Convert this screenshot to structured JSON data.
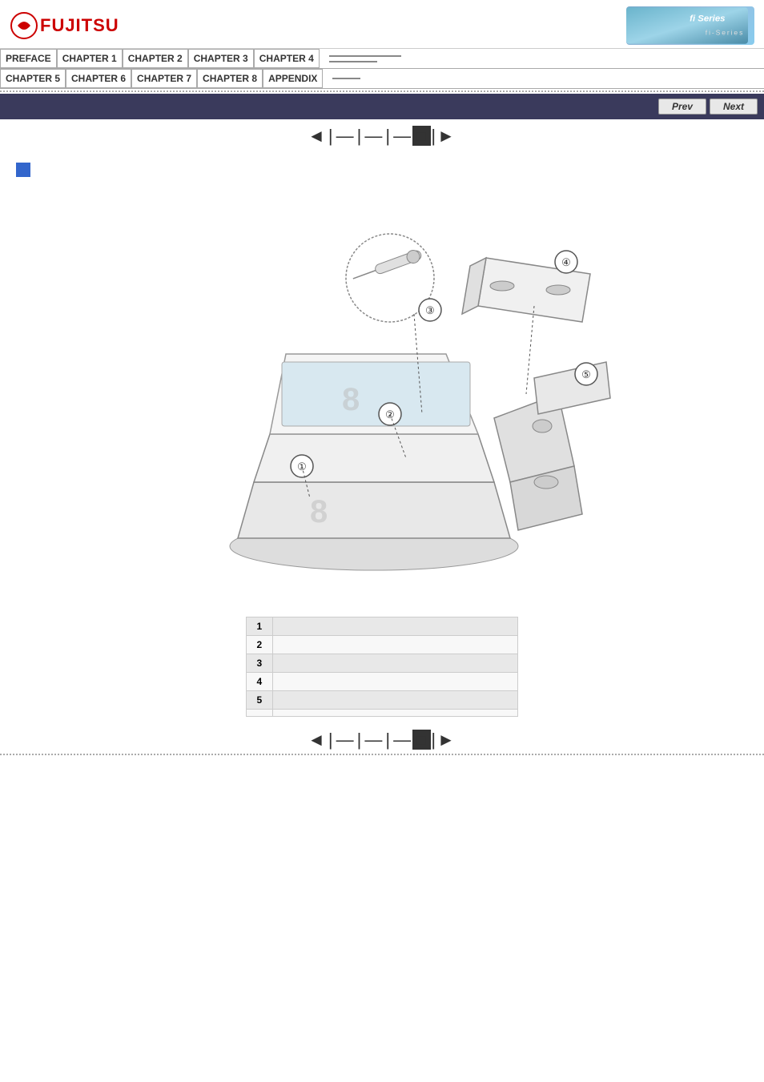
{
  "header": {
    "logo_text": "FUJITSU",
    "fi_series": "fi Series",
    "fi_sub": "fi-Series"
  },
  "nav": {
    "row1": [
      {
        "label": "PREFACE"
      },
      {
        "label": "CHAPTER 1"
      },
      {
        "label": "CHAPTER 2"
      },
      {
        "label": "CHAPTER 3"
      },
      {
        "label": "CHAPTER 4"
      }
    ],
    "row2": [
      {
        "label": "CHAPTER 5"
      },
      {
        "label": "CHAPTER 6"
      },
      {
        "label": "CHAPTER 7"
      },
      {
        "label": "CHAPTER 8"
      },
      {
        "label": "APPENDIX"
      }
    ]
  },
  "toolbar": {
    "prev_label": "Prev",
    "next_label": "Next"
  },
  "page_nav_top": "◄|—|—|—■|►",
  "page_nav_bottom": "◄|—|—|—■|►",
  "parts_table": {
    "rows": [
      {
        "num": "1",
        "label": ""
      },
      {
        "num": "2",
        "label": ""
      },
      {
        "num": "3",
        "label": ""
      },
      {
        "num": "4",
        "label": ""
      },
      {
        "num": "5",
        "label": ""
      },
      {
        "num": "",
        "label": ""
      }
    ]
  }
}
